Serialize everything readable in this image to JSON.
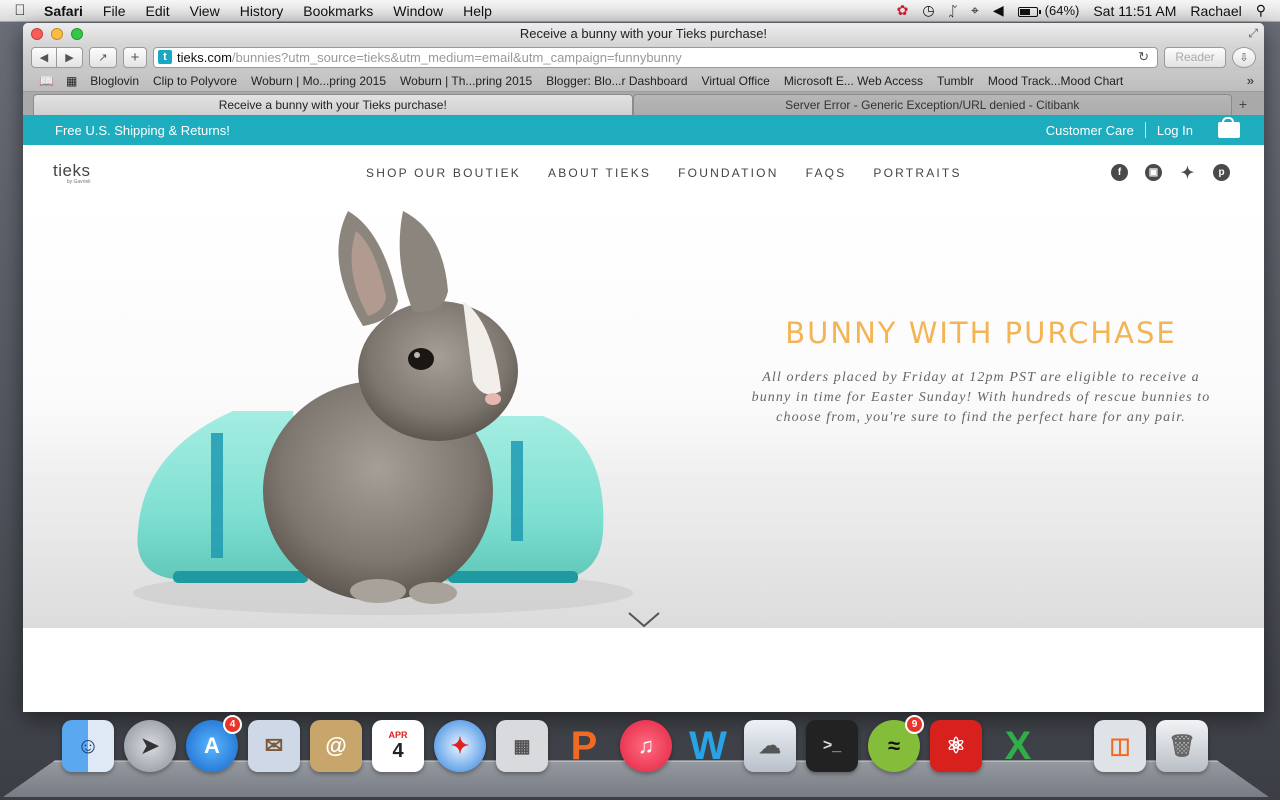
{
  "menubar": {
    "app": "Safari",
    "items": [
      "File",
      "Edit",
      "View",
      "History",
      "Bookmarks",
      "Window",
      "Help"
    ],
    "battery": "(64%)",
    "clock": "Sat 11:51 AM",
    "user": "Rachael"
  },
  "window": {
    "title": "Receive a bunny with your Tieks purchase!",
    "url_host": "tieks.com",
    "url_path": "/bunnies?utm_source=tieks&utm_medium=email&utm_campaign=funnybunny",
    "reader_label": "Reader",
    "bookmarks": [
      "Bloglovin",
      "Clip to Polyvore",
      "Woburn | Mo...pring 2015",
      "Woburn | Th...pring 2015",
      "Blogger: Blo...r Dashboard",
      "Virtual Office",
      "Microsoft E... Web Access",
      "Tumblr",
      "Mood Track...Mood Chart"
    ],
    "tabs": [
      {
        "label": "Receive a bunny with your Tieks purchase!"
      },
      {
        "label": "Server Error - Generic Exception/URL denied - Citibank"
      }
    ]
  },
  "page": {
    "promo": "Free U.S. Shipping & Returns!",
    "customer_care": "Customer Care",
    "login": "Log In",
    "logo": "tieks",
    "logo_sub": "by Gavrieli",
    "nav": [
      "SHOP OUR BOUTIEK",
      "ABOUT TIEKS",
      "FOUNDATION",
      "FAQS",
      "PORTRAITS"
    ],
    "social": [
      "facebook-icon",
      "instagram-icon",
      "twitter-icon",
      "pinterest-icon"
    ],
    "hero_title": "BUNNY WITH PURCHASE",
    "hero_body": "All orders placed by Friday at 12pm PST are eligible to receive a bunny in time for Easter Sunday! With hundreds of rescue bunnies to choose from, you're sure to find the perfect hare for any pair."
  },
  "dock": {
    "app_store_badge": "4",
    "calendar_month": "APR",
    "calendar_day": "4",
    "spotify_badge": "9"
  },
  "colors": {
    "teal": "#1eadbf",
    "hero_title": "#f3b455",
    "shoe": "#7fe0d2"
  }
}
